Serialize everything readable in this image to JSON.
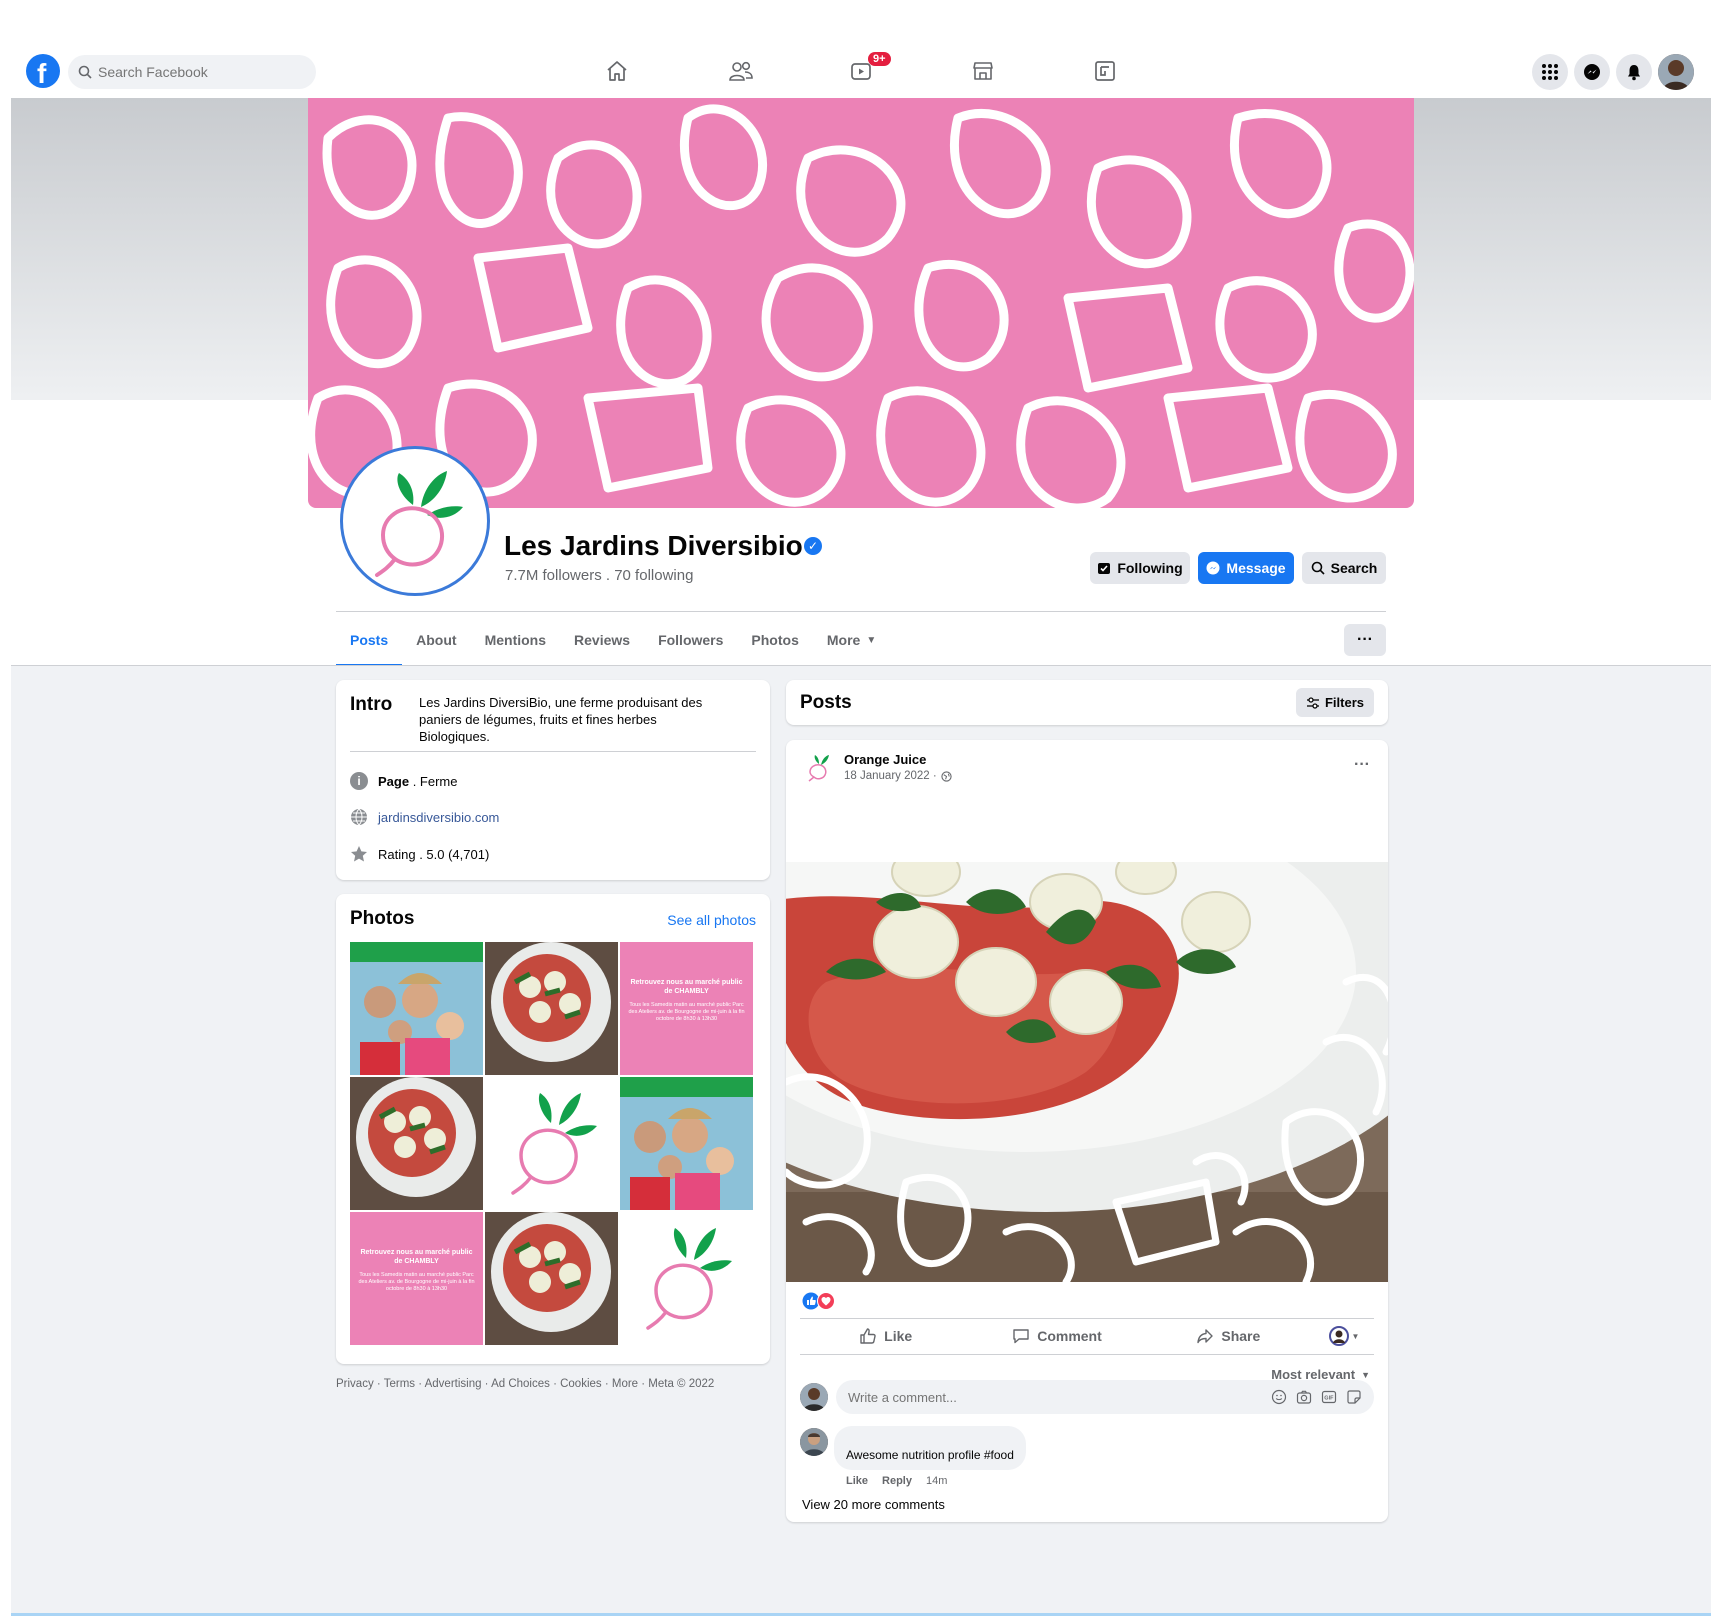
{
  "search": {
    "placeholder": "Search Facebook"
  },
  "nav": {
    "watch_badge": "9+"
  },
  "page": {
    "name": "Les Jardins Diversibio",
    "followers": "7.7M followers . 70 following"
  },
  "header_buttons": {
    "following": "Following",
    "message": "Message",
    "search": "Search"
  },
  "tabs": [
    "Posts",
    "About",
    "Mentions",
    "Reviews",
    "Followers",
    "Photos",
    "More"
  ],
  "intro": {
    "title": "Intro",
    "description": "Les Jardins DiversiBio, une ferme produisant des paniers de légumes, fruits et fines herbes Biologiques.",
    "page_label": "Page",
    "page_category": ". Ferme",
    "website": "jardinsdiversibio.com",
    "rating": "Rating . 5.0 (4,701)"
  },
  "photos": {
    "title": "Photos",
    "see_all": "See all photos",
    "poster_title": "Retrouvez nous au marché public de CHAMBLY",
    "poster_body": "Tous les Samedis matin au marché public Parc des Ateliers av. de Bourgogne de mi-juin à la fin octobre de 8h30 à 13h30"
  },
  "footer": "Privacy · Terms · Advertising · Ad Choices · Cookies · More · Meta © 2022",
  "posts": {
    "title": "Posts",
    "filters": "Filters"
  },
  "post": {
    "author": "Orange Juice",
    "date": "18 January 2022 ·",
    "like": "Like",
    "comment": "Comment",
    "share": "Share",
    "sort": "Most relevant",
    "comment_placeholder": "Write a comment...",
    "comments": [
      {
        "text": "Awesome nutrition profile #food",
        "like": "Like",
        "reply": "Reply",
        "time": "14m"
      }
    ],
    "view_more": "View 20 more comments"
  },
  "colors": {
    "accent": "#1877f2",
    "cover_pink": "#ec82b6",
    "leaf_green": "#12a14b",
    "radish_pink": "#e77bb0"
  }
}
